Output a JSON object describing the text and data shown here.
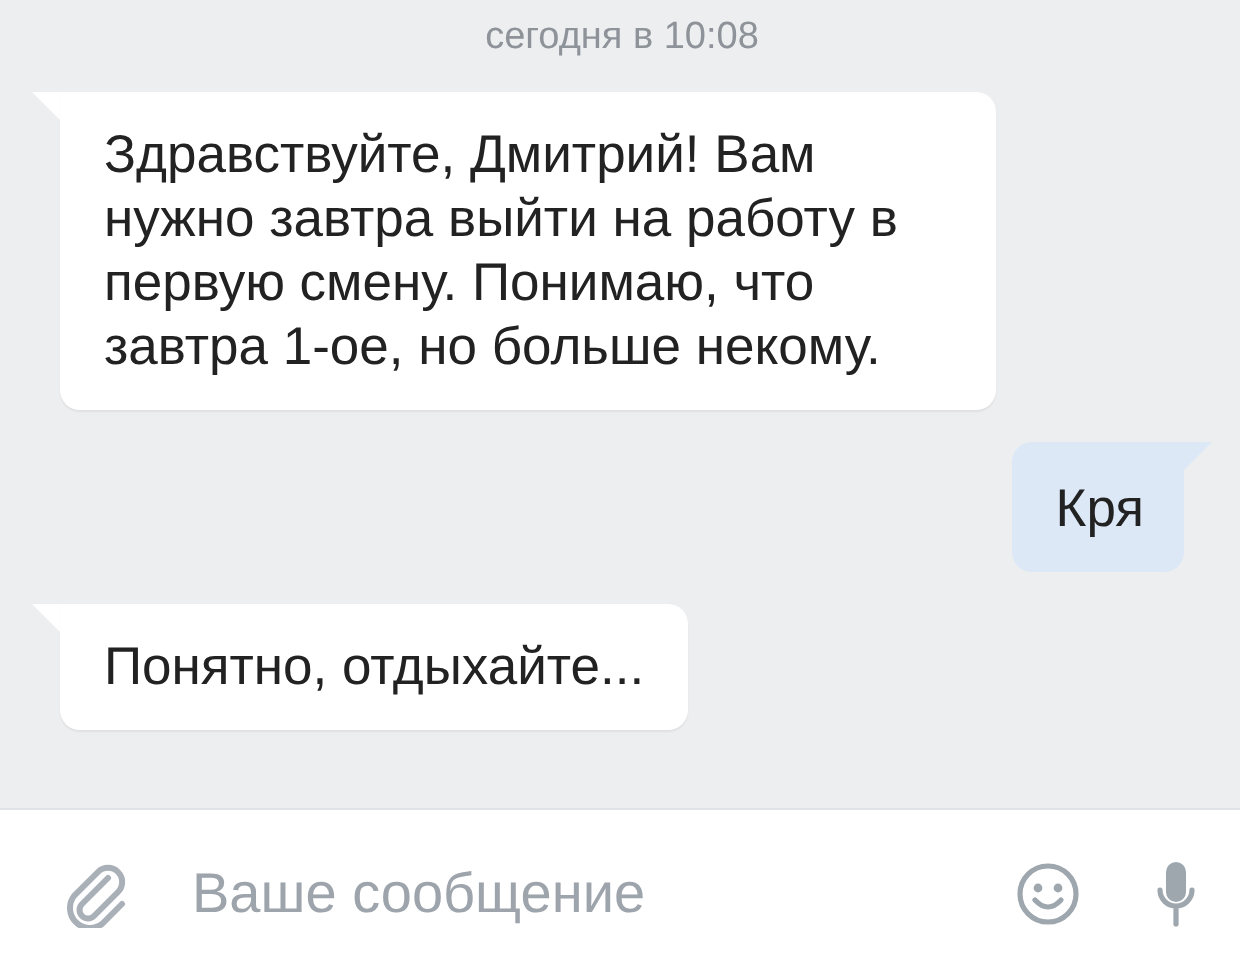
{
  "date": "сегодня в 10:08",
  "messages": [
    {
      "kind": "incoming",
      "text": "Здравствуйте, Дмитрий! Вам нужно завтра выйти на работу в первую смену. Понимаю, что завтра 1-ое, но больше некому."
    },
    {
      "kind": "outgoing",
      "text": "Кря"
    },
    {
      "kind": "incoming",
      "text": "Понятно, отдыхайте..."
    }
  ],
  "composer": {
    "placeholder": "Ваше сообщение"
  }
}
